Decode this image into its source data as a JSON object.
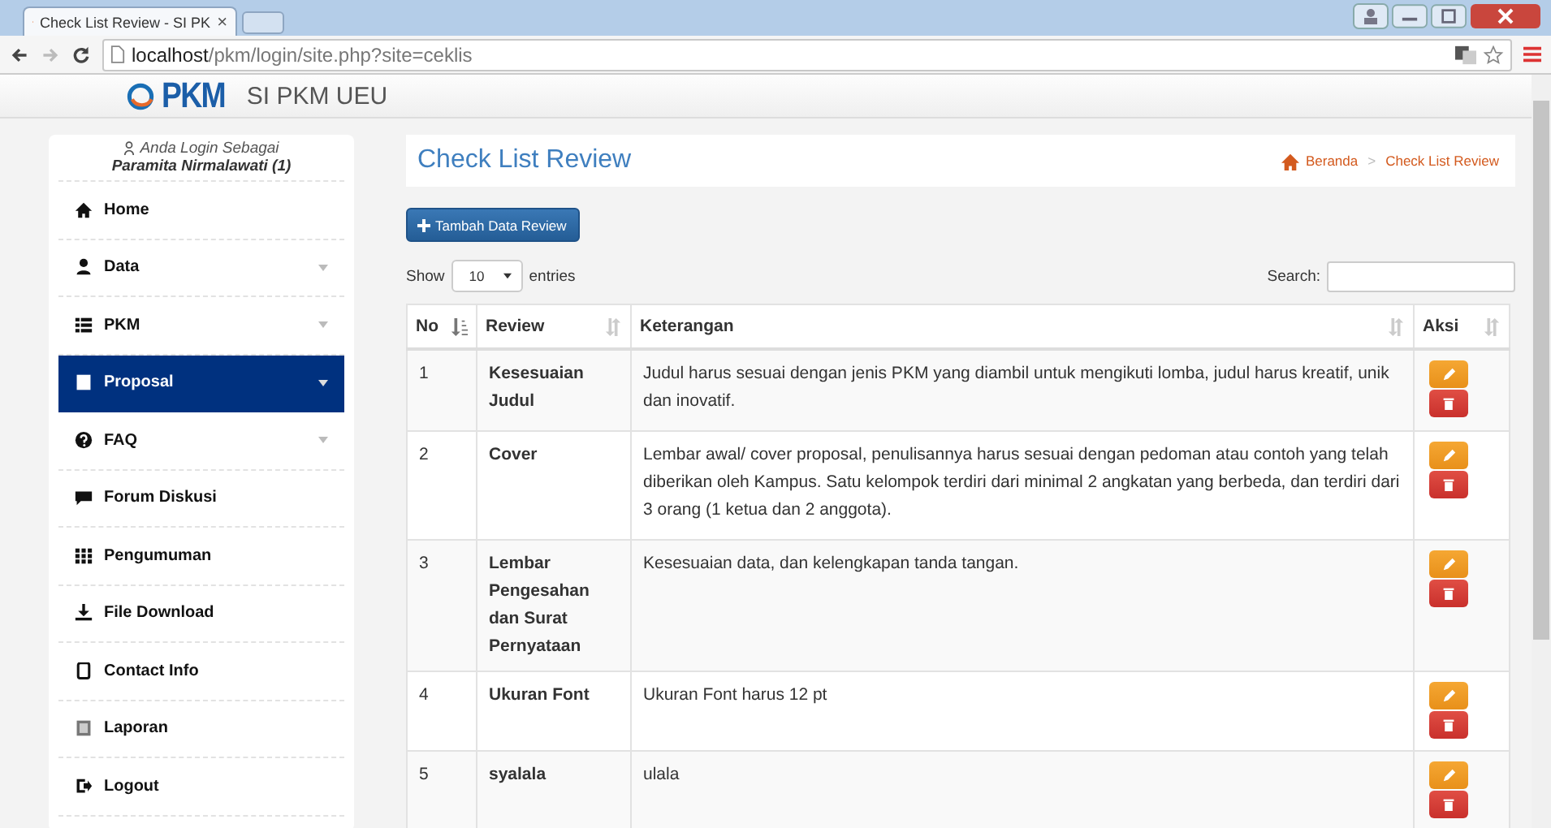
{
  "browser": {
    "tab_title": "Check List Review - SI PK",
    "tab_close": "×",
    "url": {
      "host": "localhost",
      "path": "/pkm/login/site.php?site=ceklis"
    }
  },
  "header": {
    "logo_text": "PKM",
    "site_name": "SI PKM UEU"
  },
  "sidebar": {
    "login_label": "Anda Login Sebagai",
    "user": "Paramita Nirmalawati (1)",
    "items": [
      {
        "label": "Home",
        "selected": false,
        "has_submenu": false
      },
      {
        "label": "Data",
        "selected": false,
        "has_submenu": true
      },
      {
        "label": "PKM",
        "selected": false,
        "has_submenu": true
      },
      {
        "label": "Proposal",
        "selected": true,
        "has_submenu": true
      },
      {
        "label": "FAQ",
        "selected": false,
        "has_submenu": true
      },
      {
        "label": "Forum Diskusi",
        "selected": false,
        "has_submenu": false
      },
      {
        "label": "Pengumuman",
        "selected": false,
        "has_submenu": false
      },
      {
        "label": "File Download",
        "selected": false,
        "has_submenu": false
      },
      {
        "label": "Contact Info",
        "selected": false,
        "has_submenu": false
      },
      {
        "label": "Laporan",
        "selected": false,
        "has_submenu": false
      },
      {
        "label": "Logout",
        "selected": false,
        "has_submenu": false
      }
    ]
  },
  "page": {
    "title": "Check List Review",
    "breadcrumb": [
      "Beranda",
      "Check List Review"
    ],
    "breadcrumb_separator": ">",
    "add_button": "Tambah Data Review"
  },
  "table_controls": {
    "show_label": "Show",
    "page_size": "10",
    "entries_label": "entries",
    "search_label": "Search:"
  },
  "table": {
    "columns": [
      "No",
      "Review",
      "Keterangan",
      "Aksi"
    ],
    "rows": [
      {
        "no": "1",
        "review": "Kesesuaian Judul",
        "keterangan": "Judul harus sesuai dengan jenis PKM yang diambil untuk mengikuti lomba, judul harus kreatif, unik dan inovatif."
      },
      {
        "no": "2",
        "review": "Cover",
        "keterangan": "Lembar awal/ cover proposal, penulisannya harus sesuai dengan pedoman atau contoh yang telah diberikan oleh Kampus. Satu kelompok terdiri dari minimal 2 angkatan yang berbeda, dan terdiri dari 3 orang (1 ketua dan 2 anggota)."
      },
      {
        "no": "3",
        "review": "Lembar Pengesahan dan Surat Pernyataan",
        "keterangan": "Kesesuaian data, dan kelengkapan tanda tangan."
      },
      {
        "no": "4",
        "review": "Ukuran Font",
        "keterangan": "Ukuran Font harus 12 pt"
      },
      {
        "no": "5",
        "review": "syalala",
        "keterangan": "ulala"
      }
    ]
  }
}
